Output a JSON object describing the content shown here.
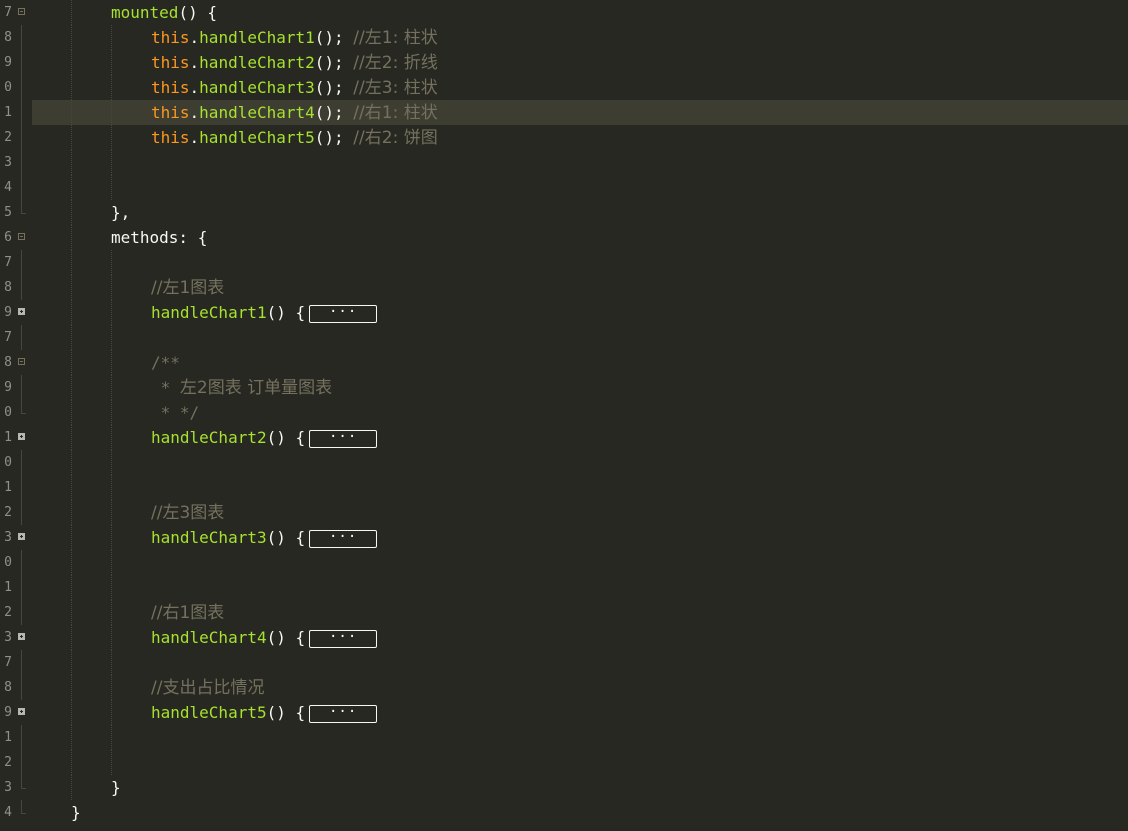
{
  "editor": {
    "theme_colors": {
      "background": "#272822",
      "current_line": "#3e3d32",
      "this_keyword": "#fd971f",
      "function_name": "#a6e22e",
      "comment": "#75715e",
      "punctuation": "#f8f8f2",
      "line_number": "#8f908a"
    },
    "lines": [
      {
        "num": "7",
        "fold": "open",
        "indent": 111,
        "tokens": [
          {
            "t": "fn",
            "v": "mounted"
          },
          {
            "t": "pn",
            "v": "() {"
          }
        ]
      },
      {
        "num": "8",
        "indent": 151,
        "tokens": [
          {
            "t": "kw",
            "v": "this"
          },
          {
            "t": "pn",
            "v": "."
          },
          {
            "t": "fn",
            "v": "handleChart1"
          },
          {
            "t": "pn",
            "v": "(); "
          },
          {
            "t": "cm",
            "v": "//左1: 柱状"
          }
        ]
      },
      {
        "num": "9",
        "indent": 151,
        "tokens": [
          {
            "t": "kw",
            "v": "this"
          },
          {
            "t": "pn",
            "v": "."
          },
          {
            "t": "fn",
            "v": "handleChart2"
          },
          {
            "t": "pn",
            "v": "(); "
          },
          {
            "t": "cm",
            "v": "//左2: 折线"
          }
        ]
      },
      {
        "num": "0",
        "indent": 151,
        "tokens": [
          {
            "t": "kw",
            "v": "this"
          },
          {
            "t": "pn",
            "v": "."
          },
          {
            "t": "fn",
            "v": "handleChart3"
          },
          {
            "t": "pn",
            "v": "(); "
          },
          {
            "t": "cm",
            "v": "//左3: 柱状"
          }
        ]
      },
      {
        "num": "1",
        "indent": 151,
        "current": true,
        "tokens": [
          {
            "t": "kw",
            "v": "this"
          },
          {
            "t": "pn",
            "v": "."
          },
          {
            "t": "fn",
            "v": "handleChart4"
          },
          {
            "t": "pn",
            "v": "(); "
          },
          {
            "t": "cm",
            "v": "//右1: 柱状"
          }
        ]
      },
      {
        "num": "2",
        "indent": 151,
        "tokens": [
          {
            "t": "kw",
            "v": "this"
          },
          {
            "t": "pn",
            "v": "."
          },
          {
            "t": "fn",
            "v": "handleChart5"
          },
          {
            "t": "pn",
            "v": "(); "
          },
          {
            "t": "cm",
            "v": "//右2: 饼图"
          }
        ]
      },
      {
        "num": "3",
        "indent": 151,
        "tokens": []
      },
      {
        "num": "4",
        "indent": 151,
        "tokens": []
      },
      {
        "num": "5",
        "fold": "end",
        "indent": 111,
        "tokens": [
          {
            "t": "pn",
            "v": "},"
          }
        ]
      },
      {
        "num": "6",
        "fold": "open",
        "indent": 111,
        "tokens": [
          {
            "t": "pn",
            "v": "methods: {"
          }
        ]
      },
      {
        "num": "7",
        "indent": 151,
        "tokens": []
      },
      {
        "num": "8",
        "indent": 151,
        "tokens": [
          {
            "t": "cm",
            "v": "//左1图表"
          }
        ]
      },
      {
        "num": "9",
        "fold": "collapsed",
        "indent": 151,
        "tokens": [
          {
            "t": "fn",
            "v": "handleChart1"
          },
          {
            "t": "pn",
            "v": "() {"
          },
          {
            "t": "ellipsis",
            "v": "···"
          }
        ]
      },
      {
        "num": "7",
        "indent": 151,
        "tokens": []
      },
      {
        "num": "8",
        "fold": "open",
        "indent": 151,
        "tokens": [
          {
            "t": "cmm",
            "v": "/**"
          }
        ]
      },
      {
        "num": "9",
        "indent": 151,
        "tokens": [
          {
            "t": "cmm",
            "v": " * "
          },
          {
            "t": "cm",
            "v": "左2图表 订单量图表"
          }
        ]
      },
      {
        "num": "0",
        "fold": "end",
        "indent": 151,
        "tokens": [
          {
            "t": "cmm",
            "v": " * */"
          }
        ]
      },
      {
        "num": "1",
        "fold": "collapsed",
        "indent": 151,
        "tokens": [
          {
            "t": "fn",
            "v": "handleChart2"
          },
          {
            "t": "pn",
            "v": "() {"
          },
          {
            "t": "ellipsis",
            "v": "···"
          }
        ]
      },
      {
        "num": "0",
        "indent": 151,
        "tokens": []
      },
      {
        "num": "1",
        "indent": 151,
        "tokens": []
      },
      {
        "num": "2",
        "indent": 151,
        "tokens": [
          {
            "t": "cm",
            "v": "//左3图表"
          }
        ]
      },
      {
        "num": "3",
        "fold": "collapsed",
        "indent": 151,
        "tokens": [
          {
            "t": "fn",
            "v": "handleChart3"
          },
          {
            "t": "pn",
            "v": "() {"
          },
          {
            "t": "ellipsis",
            "v": "···"
          }
        ]
      },
      {
        "num": "0",
        "indent": 151,
        "tokens": []
      },
      {
        "num": "1",
        "indent": 151,
        "tokens": []
      },
      {
        "num": "2",
        "indent": 151,
        "tokens": [
          {
            "t": "cm",
            "v": "//右1图表"
          }
        ]
      },
      {
        "num": "3",
        "fold": "collapsed",
        "indent": 151,
        "tokens": [
          {
            "t": "fn",
            "v": "handleChart4"
          },
          {
            "t": "pn",
            "v": "() {"
          },
          {
            "t": "ellipsis",
            "v": "···"
          }
        ]
      },
      {
        "num": "7",
        "indent": 151,
        "tokens": []
      },
      {
        "num": "8",
        "indent": 151,
        "tokens": [
          {
            "t": "cm",
            "v": "//支出占比情况"
          }
        ]
      },
      {
        "num": "9",
        "fold": "collapsed",
        "indent": 151,
        "tokens": [
          {
            "t": "fn",
            "v": "handleChart5"
          },
          {
            "t": "pn",
            "v": "() {"
          },
          {
            "t": "ellipsis",
            "v": "···"
          }
        ]
      },
      {
        "num": "1",
        "indent": 151,
        "tokens": []
      },
      {
        "num": "2",
        "indent": 151,
        "tokens": []
      },
      {
        "num": "3",
        "fold": "end",
        "indent": 111,
        "tokens": [
          {
            "t": "pn",
            "v": "}"
          }
        ]
      },
      {
        "num": "4",
        "fold": "end",
        "indent": 71,
        "tokens": [
          {
            "t": "pn",
            "v": "}"
          }
        ]
      }
    ]
  }
}
